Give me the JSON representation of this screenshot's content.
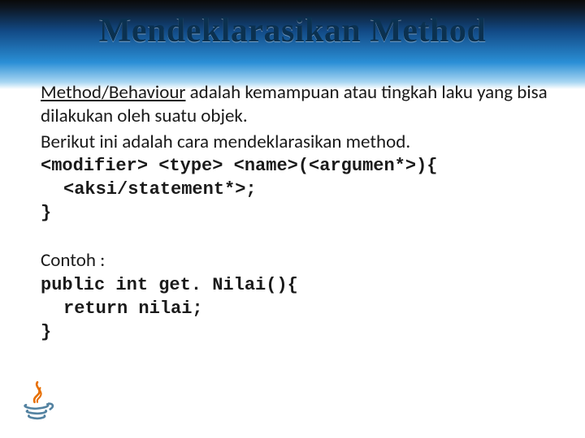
{
  "title": "Mendeklarasikan Method",
  "para1_u": "Method/Behaviour",
  "para1_rest": " adalah kemampuan atau tingkah laku yang bisa dilakukan oleh suatu objek.",
  "para2": "Berikut ini adalah cara mendeklarasikan method.",
  "code1": "<modifier> <type> <name>(<argumen*>){",
  "code2": "<aksi/statement*>;",
  "code3": "}",
  "contoh_label": "Contoh :",
  "ex1": "public int get. Nilai(){",
  "ex2": "return nilai;",
  "ex3": "}",
  "logo_name": "java-logo"
}
